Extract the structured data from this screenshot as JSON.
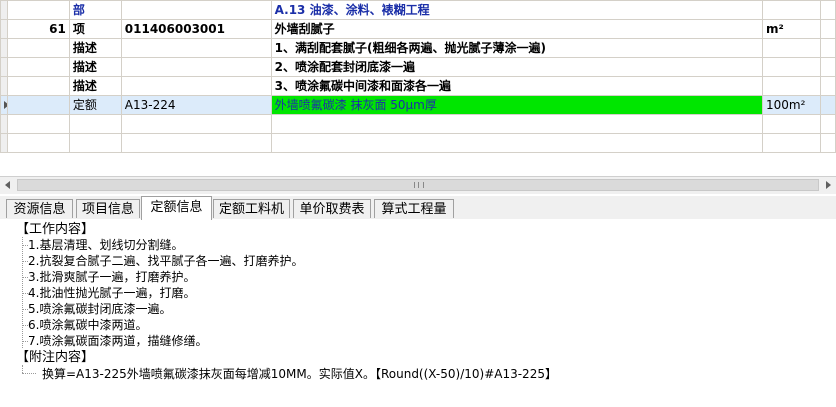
{
  "grid": {
    "rows": [
      {
        "num": "",
        "type": "部",
        "code": "",
        "name": "A.13 油漆、涂料、裱糊工程",
        "unit": ""
      },
      {
        "num": "61",
        "type": "项",
        "code": "011406003001",
        "name": "外墙刮腻子",
        "unit": "m²"
      },
      {
        "num": "",
        "type": "描述",
        "code": "",
        "name": "1、满刮配套腻子(粗细各两遍、抛光腻子薄涂一遍)",
        "unit": ""
      },
      {
        "num": "",
        "type": "描述",
        "code": "",
        "name": "2、喷涂配套封闭底漆一遍",
        "unit": ""
      },
      {
        "num": "",
        "type": "描述",
        "code": "",
        "name": "3、喷涂氟碳中间漆和面漆各一遍",
        "unit": ""
      },
      {
        "num": "",
        "type": "定额",
        "code": "A13-224",
        "name": "外墙喷氟碳漆 抹灰面 50μm厚",
        "unit": "100m²"
      }
    ]
  },
  "tabs": [
    {
      "label": "资源信息",
      "active": false
    },
    {
      "label": "项目信息",
      "active": false
    },
    {
      "label": "定额信息",
      "active": true
    },
    {
      "label": "定额工料机",
      "active": false
    },
    {
      "label": "单价取费表",
      "active": false
    },
    {
      "label": "算式工程量",
      "active": false
    }
  ],
  "details": {
    "work_title": "【工作内容】",
    "work_items": [
      "1.基层清理、划线切分割缝。",
      "2.抗裂复合腻子二遍、找平腻子各一遍、打磨养护。",
      "3.批滑爽腻子一遍，打磨养护。",
      "4.批油性抛光腻子一遍，打磨。",
      "5.喷涂氟碳封闭底漆一遍。",
      "6.喷涂氟碳中漆两道。",
      "7.喷涂氟碳面漆两道，描缝修缮。"
    ],
    "note_title": "【附注内容】",
    "note_text": "换算=A13-225外墙喷氟碳漆抹灰面每增减10MM。实际值X。【Round((X-50)/10)#A13-225】"
  }
}
